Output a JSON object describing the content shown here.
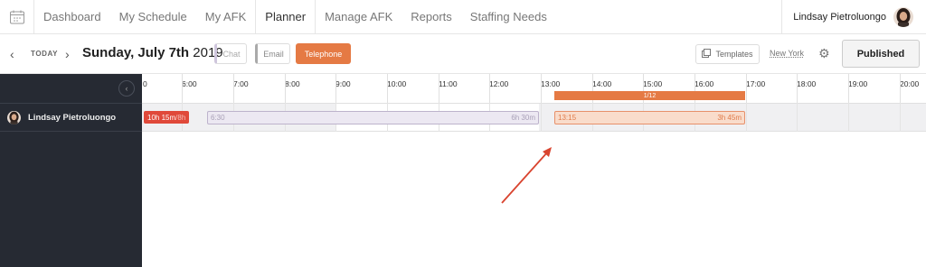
{
  "topnav": {
    "items": [
      {
        "label": "Dashboard"
      },
      {
        "label": "My Schedule"
      },
      {
        "label": "My AFK"
      },
      {
        "label": "Planner"
      },
      {
        "label": "Manage AFK"
      },
      {
        "label": "Reports"
      },
      {
        "label": "Staffing Needs"
      }
    ],
    "active": "Planner",
    "user_name": "Lindsay Pietroluongo"
  },
  "toolbar": {
    "today_label": "TODAY",
    "date_main": "Sunday, July 7th",
    "date_year": "2019",
    "channels": [
      {
        "label": "Chat",
        "state": "inactive"
      },
      {
        "label": "Email",
        "state": "inactive"
      },
      {
        "label": "Telephone",
        "state": "active"
      }
    ],
    "templates_label": "Templates",
    "timezone": "New York",
    "published_label": "Published"
  },
  "sidebar": {
    "agent_name": "Lindsay Pietroluongo"
  },
  "timeline": {
    "hours": [
      "0",
      "6:00",
      "7:00",
      "8:00",
      "9:00",
      "10:00",
      "11:00",
      "12:00",
      "13:00",
      "14:00",
      "15:00",
      "16:00",
      "17:00",
      "18:00",
      "19:00",
      "20:00"
    ],
    "coverage_label": "1/12",
    "totals_main": "10h 15m",
    "totals_target": "/8h",
    "chat_shift": {
      "start": "6:30",
      "duration": "6h 30m"
    },
    "tel_shift": {
      "start": "13:15",
      "duration": "3h 45m"
    }
  },
  "colors": {
    "accent_orange": "#e57a44",
    "totals_red": "#e0493a",
    "sidebar_bg": "#262a33",
    "annotation_arrow": "#d9442f"
  }
}
